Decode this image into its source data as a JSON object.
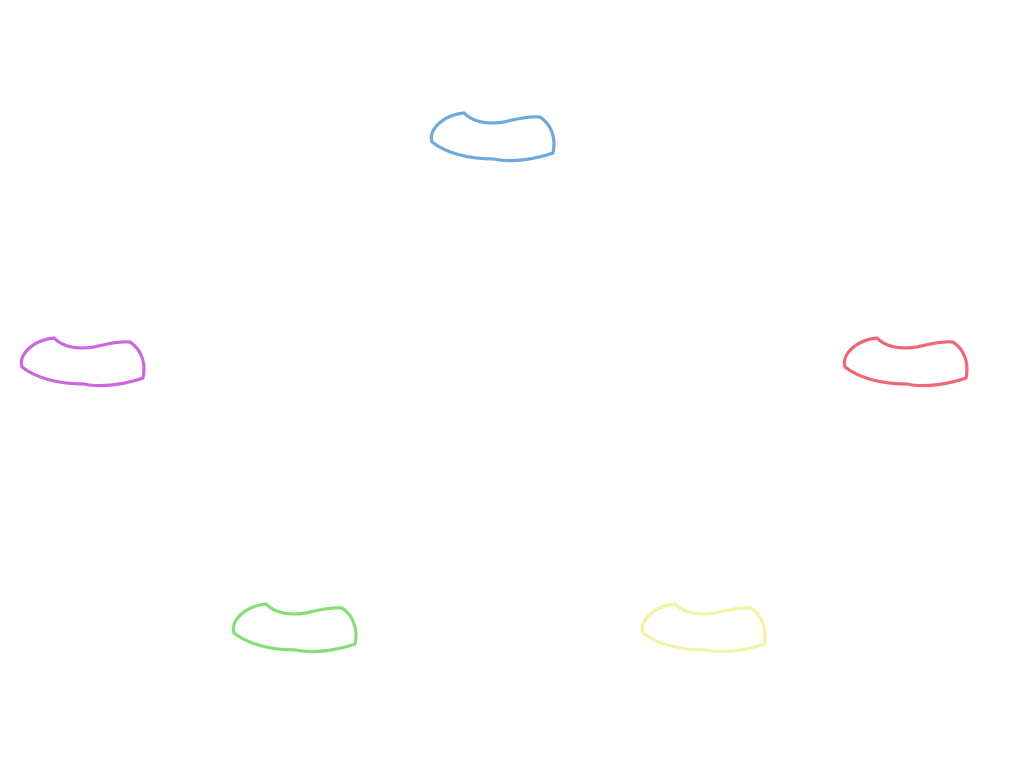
{
  "shapes": [
    {
      "id": "top",
      "color": "#6fa8dc"
    },
    {
      "id": "left",
      "color": "#cc66dd"
    },
    {
      "id": "right",
      "color": "#ee6677"
    },
    {
      "id": "bottom-left",
      "color": "#88dd77"
    },
    {
      "id": "bottom-right",
      "color": "#f3f3a3"
    }
  ]
}
